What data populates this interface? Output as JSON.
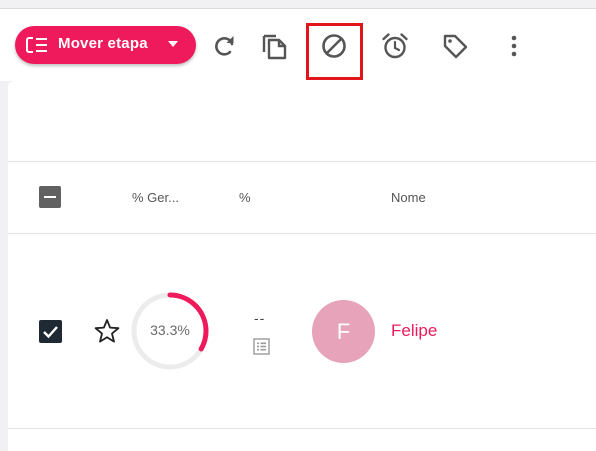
{
  "toolbar": {
    "move_stage_label": "Mover etapa",
    "icons": [
      "queue-icon",
      "refresh-icon",
      "copy-icon",
      "block-icon",
      "alarm-clock-icon",
      "tag-icon",
      "more-vert-icon"
    ],
    "accent_color": "#ee1a5c",
    "highlight_color": "#e2141c"
  },
  "table": {
    "columns": [
      "% Ger...",
      "%",
      "Nome"
    ],
    "rows": [
      {
        "selected": true,
        "favorite": false,
        "progress_label": "33.3%",
        "progress_value": 0.333,
        "percent": "--",
        "avatar_letter": "F",
        "avatar_color": "#e6a3b9",
        "name": "Felipe"
      }
    ]
  }
}
